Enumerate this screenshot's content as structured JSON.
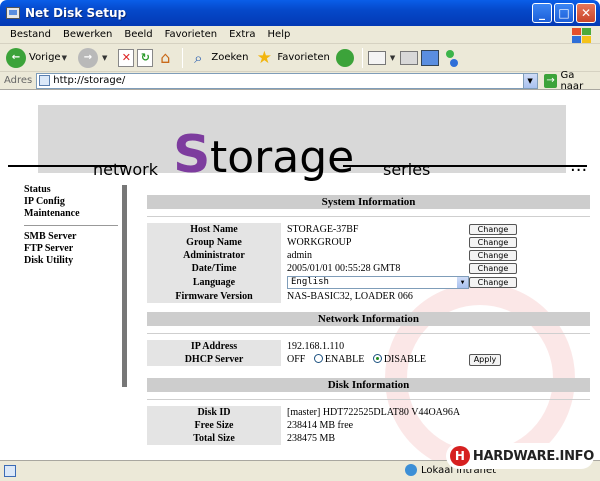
{
  "window": {
    "title": "Net Disk Setup"
  },
  "menu": [
    "Bestand",
    "Bewerken",
    "Beeld",
    "Favorieten",
    "Extra",
    "Help"
  ],
  "toolbar": {
    "back": "Vorige",
    "search": "Zoeken",
    "favorites": "Favorieten"
  },
  "address": {
    "label": "Adres",
    "url": "http://storage/",
    "go": "Ga naar"
  },
  "banner": {
    "network": "network",
    "S": "S",
    "torage": "torage",
    "series": "series",
    "dots": "..."
  },
  "sidebar": {
    "group1": [
      "Status",
      "IP Config",
      "Maintenance"
    ],
    "group2": [
      "SMB Server",
      "FTP Server",
      "Disk Utility"
    ]
  },
  "system": {
    "header": "System Information",
    "host_name_label": "Host Name",
    "host_name": "STORAGE-37BF",
    "group_name_label": "Group Name",
    "group_name": "WORKGROUP",
    "admin_label": "Administrator",
    "admin": "admin",
    "datetime_label": "Date/Time",
    "datetime": "2005/01/01 00:55:28 GMT8",
    "language_label": "Language",
    "language": "English",
    "firmware_label": "Firmware Version",
    "firmware": "NAS-BASIC32, LOADER 066",
    "change": "Change"
  },
  "network": {
    "header": "Network Information",
    "ip_label": "IP Address",
    "ip": "192.168.1.110",
    "dhcp_label": "DHCP Server",
    "dhcp_state": "OFF",
    "enable": "ENABLE",
    "disable": "DISABLE",
    "apply": "Apply"
  },
  "disk": {
    "header": "Disk Information",
    "id_label": "Disk ID",
    "id": "[master] HDT722525DLAT80 V44OA96A",
    "free_label": "Free Size",
    "free": "238414 MB free",
    "total_label": "Total Size",
    "total": "238475 MB"
  },
  "status": {
    "zone": "Lokaal intranet"
  },
  "watermark": {
    "logo": "HARDWARE.INFO",
    "badge": "H"
  },
  "colors": {
    "titlebar": "#0548c9",
    "accent_purple": "#7d3c9e",
    "section_header": "#cdcdcd"
  }
}
